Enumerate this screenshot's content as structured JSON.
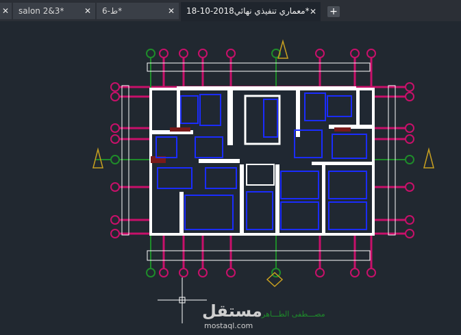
{
  "tabs": [
    {
      "label": "x",
      "close": "✕"
    },
    {
      "label": "salon 2&3*",
      "close": "✕"
    },
    {
      "label": "ط-6*",
      "close": "✕"
    },
    {
      "label": "18-10-2018معماري تنفيذي نهائي*",
      "close": "✕"
    }
  ],
  "new_tab": "+",
  "watermark": {
    "brand": "مستقل",
    "url": "mostaql.com",
    "signature": "مصـــطفى الطـــاهر"
  },
  "colors": {
    "background": "#212830",
    "axis": "#c8106a",
    "walls": "#ffffff",
    "fixtures": "#1a2cff",
    "green": "#1e8c2a",
    "north": "#c8a020"
  }
}
